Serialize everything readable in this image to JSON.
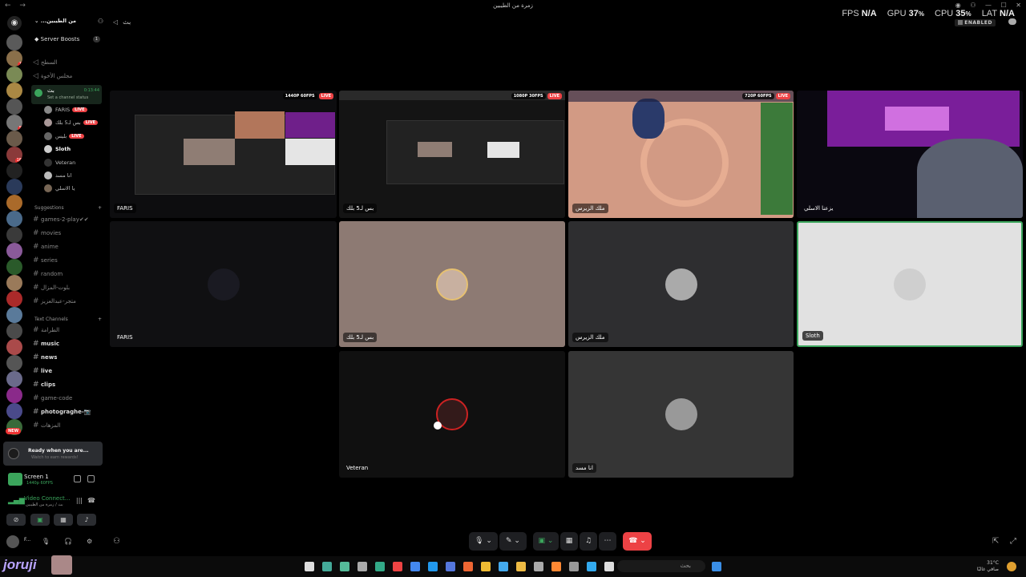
{
  "window": {
    "title": "زمرة من الطيبين",
    "nav_glyphs": "← →",
    "controls": [
      "◉",
      "⚇",
      "—",
      "☐",
      "✕"
    ]
  },
  "perf": {
    "fps_label": "FPS",
    "fps_value": "N/A",
    "gpu_label": "GPU",
    "gpu_value": "37",
    "gpu_unit": "%",
    "cpu_label": "CPU",
    "cpu_value": "35",
    "cpu_unit": "%",
    "lat_label": "LAT",
    "lat_value": "N/A",
    "enabled": "ENABLED"
  },
  "rail": {
    "dm_icon": "discord-logo",
    "new_badge": "NEW",
    "server_colors": [
      "#5a5a5a",
      "#8a6f4a",
      "#7a8a55",
      "#aa8844",
      "#555",
      "#777",
      "#6a5a4a",
      "#8a3a3a",
      "#222",
      "#2a3a5a",
      "#aa6a2a",
      "#4a6a8a",
      "#3a3a3a",
      "#8a5a9a",
      "#2a5a2a",
      "#9a7a5a",
      "#aa2a2a",
      "#5a7a9a",
      "#4a4a4a",
      "#aa4a4a",
      "#555",
      "#6a6a8a",
      "#8a2a8a",
      "#4a4a8a",
      "#3a6a3a"
    ],
    "server_badges": [
      "",
      "1",
      "",
      "",
      "",
      "5",
      "",
      "16",
      "",
      "",
      "",
      "",
      "",
      "",
      "",
      "",
      "",
      "",
      "",
      "",
      "",
      "",
      "",
      "",
      ""
    ]
  },
  "sidebar": {
    "guild_name": "من الطيبين...",
    "server_boosts": "Server Boosts",
    "boost_count": "1",
    "top_channels": [
      "السطح",
      "مجلس الأخوة"
    ],
    "active_voice": {
      "name": "بث",
      "time": "0:13:44",
      "status": "Set a channel status"
    },
    "voice_users": [
      {
        "name": "FARIS",
        "live": "LIVE"
      },
      {
        "name": "بس لـ5 بلك",
        "live": "LIVE"
      },
      {
        "name": "بليس",
        "live": "LIVE"
      },
      {
        "name": "Sloth",
        "live": ""
      },
      {
        "name": "Veteran",
        "live": ""
      },
      {
        "name": "انا مسد",
        "live": ""
      },
      {
        "name": "يا الاسلي",
        "live": ""
      }
    ],
    "suggestions_header": "Suggestions",
    "suggestions": [
      "games-2-play✔✔",
      "movies",
      "anime",
      "series",
      "random",
      "بلوت-المزال",
      "متجر-عبدالعزيز"
    ],
    "text_header": "Text Channels",
    "text_channels": [
      {
        "name": "الطرامة",
        "bright": false
      },
      {
        "name": "music",
        "bright": true
      },
      {
        "name": "news",
        "bright": true
      },
      {
        "name": "live",
        "bright": true
      },
      {
        "name": "clips",
        "bright": true
      },
      {
        "name": "game-code",
        "bright": false
      },
      {
        "name": "photograghe-📷",
        "bright": true
      },
      {
        "name": "المزهات",
        "bright": false
      }
    ]
  },
  "panels": {
    "ready_title": "Ready when you are...",
    "ready_sub": "Watch to earn rewards!",
    "screen_title": "Screen 1",
    "screen_sub": "1440p 60FPS",
    "voice_title": "Video Connect...",
    "voice_sub": "بث / زمرة من الطيبين",
    "user_name": "F..."
  },
  "stage": {
    "channel_name": "بث",
    "streams": [
      {
        "name": "FARIS",
        "quality": "1440P 60FPS",
        "live": "LIVE"
      },
      {
        "name": "بس لـ5 بلك",
        "quality": "1080P 30FPS",
        "live": "LIVE"
      },
      {
        "name": "ملك الزيرس",
        "quality": "720P 60FPS",
        "live": "LIVE"
      },
      {
        "name": "يزعنا الاسلي",
        "quality": "",
        "live": ""
      }
    ],
    "participants": [
      {
        "name": "FARIS",
        "bg": "#101012"
      },
      {
        "name": "بس لـ5 بلك",
        "bg": "#8d7a73"
      },
      {
        "name": "ملك الزيرس",
        "bg": "#2e2e30"
      },
      {
        "name": "Sloth",
        "bg": "#e1e1e1"
      },
      {
        "name": "Veteran",
        "bg": "#101010"
      },
      {
        "name": "انا مسد",
        "bg": "#353535"
      }
    ]
  },
  "taskbar": {
    "user_tag": "joruji",
    "search_placeholder": "بحث",
    "weather_temp": "31°C",
    "weather_desc": "صافي غالبًا"
  }
}
